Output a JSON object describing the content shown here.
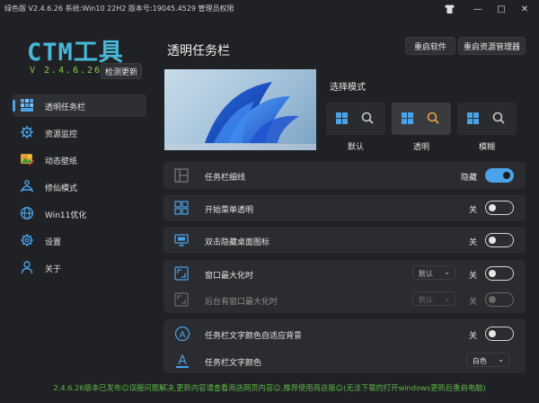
{
  "titlebar": {
    "text": "绿色版 V2.4.6.26  系统:Win10 22H2  版本号:19045.4529  管理员权限",
    "shirt_icon": "tshirt-icon",
    "min": "—",
    "max": "□",
    "close": "✕"
  },
  "app": {
    "logo": "CTM工具",
    "version": "V 2.4.6.26",
    "check_update": "检测更新"
  },
  "sidebar": {
    "items": [
      {
        "label": "透明任务栏",
        "icon": "taskbar-icon",
        "active": true
      },
      {
        "label": "资源监控",
        "icon": "monitor-gear-icon",
        "active": false
      },
      {
        "label": "动态壁纸",
        "icon": "wallpaper-icon",
        "active": false
      },
      {
        "label": "修仙模式",
        "icon": "cultivation-icon",
        "active": false
      },
      {
        "label": "Win11优化",
        "icon": "globe-icon",
        "active": false
      },
      {
        "label": "设置",
        "icon": "gear-icon",
        "active": false
      },
      {
        "label": "关于",
        "icon": "user-icon",
        "active": false
      }
    ]
  },
  "header": {
    "title": "透明任务栏",
    "restart_app": "重启软件",
    "restart_explorer": "重启资源管理器"
  },
  "mode": {
    "label": "选择模式",
    "options": [
      "默认",
      "透明",
      "模糊"
    ],
    "selected": "透明"
  },
  "settings": [
    {
      "label": "任务栏细线",
      "state": "隐藏",
      "toggle": "on",
      "icon": "grid-layout-icon"
    },
    {
      "label": "开始菜单透明",
      "state": "关",
      "toggle": "off",
      "icon": "start-menu-icon"
    },
    {
      "label": "双击隐藏桌面图标",
      "state": "关",
      "toggle": "off",
      "icon": "desktop-monitor-icon"
    },
    {
      "label": "窗口最大化时",
      "state": "关",
      "toggle": "off",
      "icon": "maximize-icon",
      "dropdown": "默认"
    },
    {
      "label": "后台有窗口最大化时",
      "state": "关",
      "toggle": "off",
      "icon": "maximize-icon",
      "dropdown": "默认",
      "disabled": true
    },
    {
      "label": "任务栏文字颜色自适应背景",
      "state": "关",
      "toggle": "off",
      "icon": "auto-text-icon"
    },
    {
      "label": "任务栏文字颜色",
      "icon": "font-color-icon",
      "dropdown": "白色"
    }
  ],
  "footer": {
    "text": "2.4.6.26版本已发布☺误报问题解决,更新内容请查看商店网页内容☺,推荐使用商店版☺(无法下载的打开windows更新后重启电脑)"
  },
  "colors": {
    "accent": "#4aa3e8",
    "logo": "#46b8d8",
    "version": "#8ad14a",
    "footer": "#5fb84a"
  }
}
